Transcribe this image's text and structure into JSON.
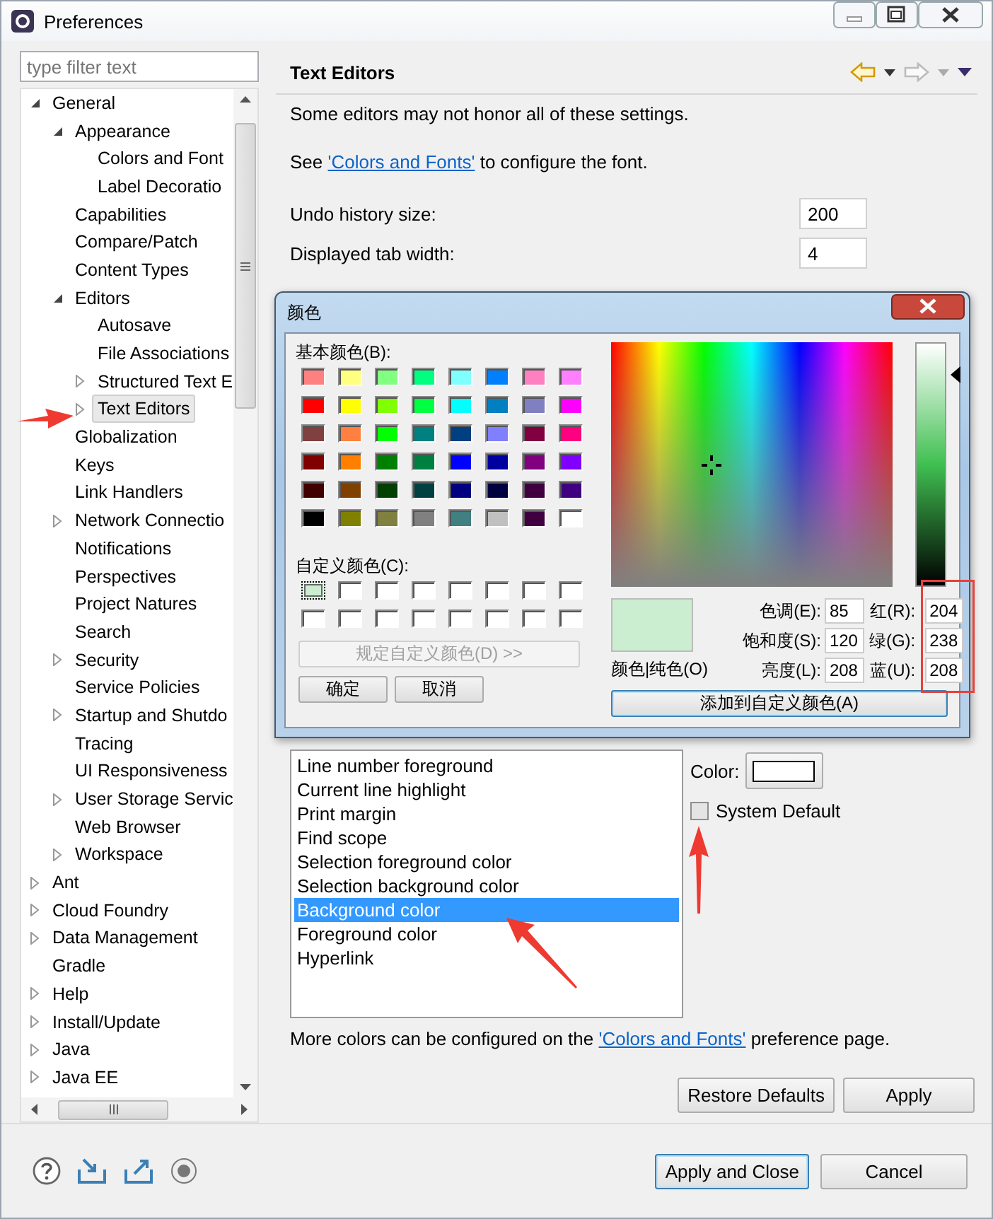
{
  "window": {
    "title": "Preferences"
  },
  "filter": {
    "placeholder": "type filter text"
  },
  "tree": [
    {
      "label": "General",
      "kind": "branch",
      "expanded": true,
      "selected": false,
      "children": [
        {
          "label": "Appearance",
          "kind": "branch",
          "expanded": true,
          "selected": false,
          "children": [
            {
              "label": "Colors and Font",
              "kind": "leaf",
              "selected": false
            },
            {
              "label": "Label Decoratio",
              "kind": "leaf",
              "selected": false
            }
          ]
        },
        {
          "label": "Capabilities",
          "kind": "leaf",
          "selected": false
        },
        {
          "label": "Compare/Patch",
          "kind": "leaf",
          "selected": false
        },
        {
          "label": "Content Types",
          "kind": "leaf",
          "selected": false
        },
        {
          "label": "Editors",
          "kind": "branch",
          "expanded": true,
          "selected": false,
          "children": [
            {
              "label": "Autosave",
              "kind": "leaf",
              "selected": false
            },
            {
              "label": "File Associations",
              "kind": "leaf",
              "selected": false
            },
            {
              "label": "Structured Text E",
              "kind": "branch",
              "expanded": false,
              "selected": false
            },
            {
              "label": "Text Editors",
              "kind": "branch",
              "expanded": false,
              "selected": true
            }
          ]
        },
        {
          "label": "Globalization",
          "kind": "leaf",
          "selected": false
        },
        {
          "label": "Keys",
          "kind": "leaf",
          "selected": false
        },
        {
          "label": "Link Handlers",
          "kind": "leaf",
          "selected": false
        },
        {
          "label": "Network Connectio",
          "kind": "branch",
          "expanded": false,
          "selected": false
        },
        {
          "label": "Notifications",
          "kind": "leaf",
          "selected": false
        },
        {
          "label": "Perspectives",
          "kind": "leaf",
          "selected": false
        },
        {
          "label": "Project Natures",
          "kind": "leaf",
          "selected": false
        },
        {
          "label": "Search",
          "kind": "leaf",
          "selected": false
        },
        {
          "label": "Security",
          "kind": "branch",
          "expanded": false,
          "selected": false
        },
        {
          "label": "Service Policies",
          "kind": "leaf",
          "selected": false
        },
        {
          "label": "Startup and Shutdo",
          "kind": "branch",
          "expanded": false,
          "selected": false
        },
        {
          "label": "Tracing",
          "kind": "leaf",
          "selected": false
        },
        {
          "label": "UI Responsiveness",
          "kind": "leaf",
          "selected": false
        },
        {
          "label": "User Storage Servic",
          "kind": "branch",
          "expanded": false,
          "selected": false
        },
        {
          "label": "Web Browser",
          "kind": "leaf",
          "selected": false
        },
        {
          "label": "Workspace",
          "kind": "branch",
          "expanded": false,
          "selected": false
        }
      ]
    },
    {
      "label": "Ant",
      "kind": "branch",
      "expanded": false,
      "selected": false
    },
    {
      "label": "Cloud Foundry",
      "kind": "branch",
      "expanded": false,
      "selected": false
    },
    {
      "label": "Data Management",
      "kind": "branch",
      "expanded": false,
      "selected": false
    },
    {
      "label": "Gradle",
      "kind": "leaf",
      "selected": false
    },
    {
      "label": "Help",
      "kind": "branch",
      "expanded": false,
      "selected": false
    },
    {
      "label": "Install/Update",
      "kind": "branch",
      "expanded": false,
      "selected": false
    },
    {
      "label": "Java",
      "kind": "branch",
      "expanded": false,
      "selected": false
    },
    {
      "label": "Java EE",
      "kind": "branch",
      "expanded": false,
      "selected": false
    }
  ],
  "page": {
    "title": "Text Editors",
    "note": "Some editors may not honor all of these settings.",
    "see": {
      "before": "See ",
      "link": "'Colors and Fonts'",
      "after": " to configure the font."
    },
    "fields": [
      {
        "label": "Undo history size:",
        "value": "200"
      },
      {
        "label": "Displayed tab width:",
        "value": "4"
      }
    ],
    "color_options": [
      {
        "label": "Line number foreground",
        "selected": false
      },
      {
        "label": "Current line highlight",
        "selected": false
      },
      {
        "label": "Print margin",
        "selected": false
      },
      {
        "label": "Find scope",
        "selected": false
      },
      {
        "label": "Selection foreground color",
        "selected": false
      },
      {
        "label": "Selection background color",
        "selected": false
      },
      {
        "label": "Background color",
        "selected": true
      },
      {
        "label": "Foreground color",
        "selected": false
      },
      {
        "label": "Hyperlink",
        "selected": false
      }
    ],
    "color_label": "Color:",
    "system_default": {
      "label": "System Default",
      "checked": false
    },
    "more": {
      "before": "More colors can be configured on the ",
      "link": "'Colors and Fonts'",
      "after": " preference page."
    },
    "buttons": [
      "Restore Defaults",
      "Apply"
    ]
  },
  "footer_buttons": [
    {
      "label": "Apply and Close",
      "default": true
    },
    {
      "label": "Cancel",
      "default": false
    }
  ],
  "color_dialog": {
    "title": "颜色",
    "basic_label": "基本颜色(B):",
    "basic_colors": [
      {
        "color": "#ff8080"
      },
      {
        "color": "#ffff80"
      },
      {
        "color": "#80ff80"
      },
      {
        "color": "#00ff80"
      },
      {
        "color": "#80ffff"
      },
      {
        "color": "#0080ff"
      },
      {
        "color": "#ff80c0"
      },
      {
        "color": "#ff80ff"
      },
      {
        "color": "#ff0000"
      },
      {
        "color": "#ffff00"
      },
      {
        "color": "#80ff00"
      },
      {
        "color": "#00ff40"
      },
      {
        "color": "#00ffff"
      },
      {
        "color": "#0080c0"
      },
      {
        "color": "#8080c0"
      },
      {
        "color": "#ff00ff"
      },
      {
        "color": "#804040"
      },
      {
        "color": "#ff8040"
      },
      {
        "color": "#00ff00"
      },
      {
        "color": "#008080"
      },
      {
        "color": "#004080"
      },
      {
        "color": "#8080ff"
      },
      {
        "color": "#800040"
      },
      {
        "color": "#ff0080"
      },
      {
        "color": "#800000"
      },
      {
        "color": "#ff8000"
      },
      {
        "color": "#008000"
      },
      {
        "color": "#008040"
      },
      {
        "color": "#0000ff"
      },
      {
        "color": "#0000a0"
      },
      {
        "color": "#800080"
      },
      {
        "color": "#8000ff"
      },
      {
        "color": "#400000"
      },
      {
        "color": "#804000"
      },
      {
        "color": "#004000"
      },
      {
        "color": "#004040"
      },
      {
        "color": "#000080"
      },
      {
        "color": "#000040"
      },
      {
        "color": "#400040"
      },
      {
        "color": "#400080"
      },
      {
        "color": "#000000"
      },
      {
        "color": "#808000"
      },
      {
        "color": "#808040"
      },
      {
        "color": "#808080"
      },
      {
        "color": "#408080"
      },
      {
        "color": "#c0c0c0"
      },
      {
        "color": "#400040"
      },
      {
        "color": "#ffffff"
      }
    ],
    "custom_label": "自定义颜色(C):",
    "custom_colors": [
      {
        "color": "#cceed0",
        "selected": true
      },
      {
        "color": "#ffffff",
        "selected": false
      },
      {
        "color": "#ffffff",
        "selected": false
      },
      {
        "color": "#ffffff",
        "selected": false
      },
      {
        "color": "#ffffff",
        "selected": false
      },
      {
        "color": "#ffffff",
        "selected": false
      },
      {
        "color": "#ffffff",
        "selected": false
      },
      {
        "color": "#ffffff",
        "selected": false
      },
      {
        "color": "#ffffff",
        "selected": false
      },
      {
        "color": "#ffffff",
        "selected": false
      },
      {
        "color": "#ffffff",
        "selected": false
      },
      {
        "color": "#ffffff",
        "selected": false
      },
      {
        "color": "#ffffff",
        "selected": false
      },
      {
        "color": "#ffffff",
        "selected": false
      },
      {
        "color": "#ffffff",
        "selected": false
      },
      {
        "color": "#ffffff",
        "selected": false
      }
    ],
    "define_button": {
      "label": "规定自定义颜色(D) >>",
      "disabled": true
    },
    "ok": "确定",
    "cancel": "取消",
    "preview_label": "颜色|纯色(O)",
    "hsl": [
      {
        "label": "色调(E):",
        "value": "85"
      },
      {
        "label": "饱和度(S):",
        "value": "120"
      },
      {
        "label": "亮度(L):",
        "value": "208"
      }
    ],
    "rgb": [
      {
        "label": "红(R):",
        "value": "204"
      },
      {
        "label": "绿(G):",
        "value": "238"
      },
      {
        "label": "蓝(U):",
        "value": "208"
      }
    ],
    "luminance": {
      "level": 0.87
    },
    "add_button": "添加到自定义颜色(A)"
  }
}
